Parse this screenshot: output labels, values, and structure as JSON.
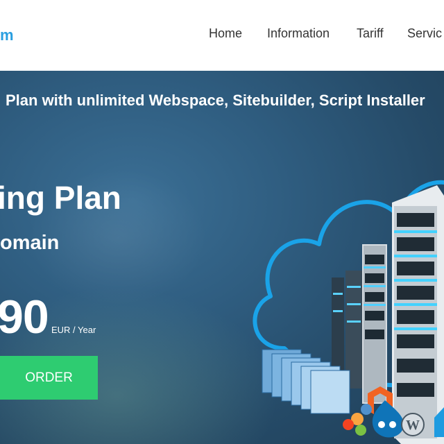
{
  "header": {
    "logo_fragment": "m",
    "nav": [
      {
        "label": "Home"
      },
      {
        "label": "Information"
      },
      {
        "label": "Tariff"
      },
      {
        "label": "Servic"
      }
    ]
  },
  "hero": {
    "tagline": "Plan with unlimited Webspace, Sitebuilder, Script Installer",
    "plan_title": "ing Plan",
    "plan_subtitle": "omain",
    "price": "90",
    "price_unit": "EUR / Year",
    "order_label": "ORDER"
  },
  "colors": {
    "accent_blue": "#2a9fe0",
    "order_green": "#2ecc71",
    "hero_bg": "#2f5d80",
    "cloud_outline": "#1aa3e8"
  },
  "icons": [
    "cloud-outline-icon",
    "server-rack-icon",
    "browser-window-stack-icon",
    "magento-icon",
    "joomla-icon",
    "drupal-icon",
    "wordpress-icon"
  ]
}
